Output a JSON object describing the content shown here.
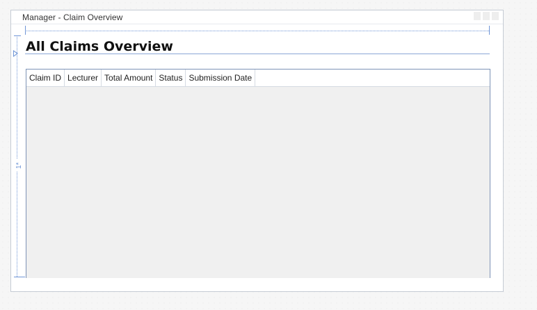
{
  "window": {
    "title": "Manager - Claim Overview"
  },
  "designer": {
    "row_size_marker": "1*"
  },
  "page": {
    "heading": "All Claims Overview"
  },
  "claims_grid": {
    "columns": [
      "Claim ID",
      "Lecturer",
      "Total Amount",
      "Status",
      "Submission Date"
    ],
    "rows": []
  }
}
